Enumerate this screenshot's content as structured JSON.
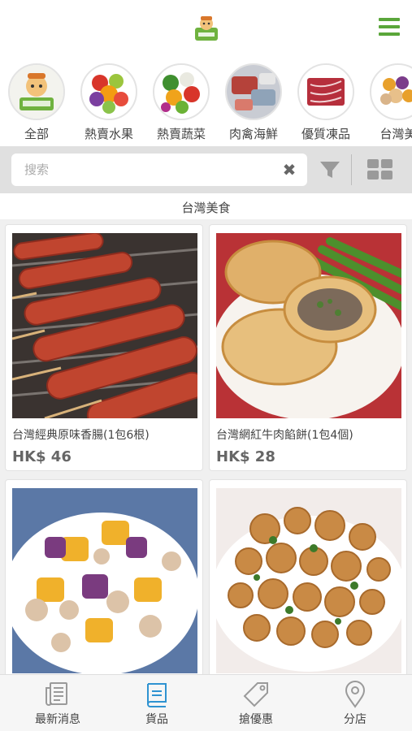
{
  "colors": {
    "accent": "#5aa63a",
    "active_tab": "#2f93d1",
    "icon_gray": "#9a9a9a"
  },
  "header": {
    "logo_icon": "farm-logo-icon",
    "menu_icon": "hamburger-menu-icon"
  },
  "categories": [
    {
      "label": "全部",
      "icon": "farm-mascot-icon"
    },
    {
      "label": "熱賣水果",
      "icon": "fruit-icon"
    },
    {
      "label": "熱賣蔬菜",
      "icon": "vegetable-icon"
    },
    {
      "label": "肉禽海鮮",
      "icon": "meat-seafood-icon"
    },
    {
      "label": "優質凍品",
      "icon": "frozen-meat-icon"
    },
    {
      "label": "台灣美",
      "icon": "taiwan-food-icon"
    }
  ],
  "search": {
    "placeholder": "搜索",
    "value": "",
    "clear_icon": "clear-icon",
    "filter_icon": "filter-icon",
    "grid_icon": "grid-view-icon"
  },
  "section": {
    "title": "台灣美食"
  },
  "products": [
    {
      "name": "台灣經典原味香腸(1包6根)",
      "price": "HK$ 46",
      "image": "sausage-image"
    },
    {
      "name": "台灣網紅牛肉餡餅(1包4個)",
      "price": "HK$ 28",
      "image": "beef-pie-image"
    },
    {
      "name": "",
      "price": "",
      "image": "taro-balls-image"
    },
    {
      "name": "",
      "price": "",
      "image": "popcorn-chicken-image"
    }
  ],
  "bottom_nav": [
    {
      "label": "最新消息",
      "icon": "news-icon"
    },
    {
      "label": "貨品",
      "icon": "book-icon",
      "active": true
    },
    {
      "label": "搶優惠",
      "icon": "tag-icon"
    },
    {
      "label": "分店",
      "icon": "location-pin-icon"
    }
  ]
}
